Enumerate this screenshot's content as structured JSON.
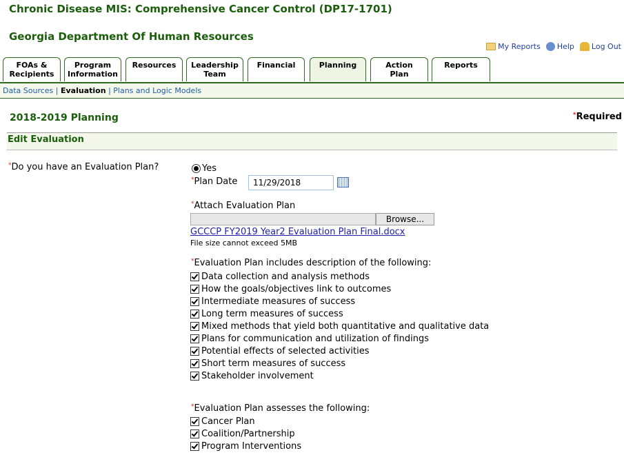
{
  "header": {
    "app_title": "Chronic Disease MIS: Comprehensive Cancer Control (DP17-1701)",
    "org": "Georgia Department Of Human Resources",
    "links": [
      "My Reports",
      "Help",
      "Log Out"
    ]
  },
  "tabs": [
    [
      "FOAs &",
      "Recipients"
    ],
    [
      "Program",
      "Information"
    ],
    [
      "Resources",
      ""
    ],
    [
      "Leadership",
      "Team"
    ],
    [
      "Financial",
      ""
    ],
    [
      "Planning",
      ""
    ],
    [
      "Action",
      "Plan"
    ],
    [
      "Reports",
      ""
    ]
  ],
  "subnav": [
    "Data Sources",
    "Evaluation",
    "Plans and Logic Models"
  ],
  "page": {
    "title": "2018-2019 Planning",
    "required": "Required",
    "section": "Edit Evaluation"
  },
  "form": {
    "question": "Do you have an Evaluation Plan?",
    "radio_yes": "Yes",
    "plan_date_label": "Plan Date",
    "plan_date": "11/29/2018",
    "attach_label": "Attach Evaluation Plan",
    "browse": "Browse...",
    "file_link": "GCCCP FY2019 Year2 Evaluation Plan Final.docx",
    "file_note": "File size cannot exceed 5MB",
    "includes_label": "Evaluation Plan includes description of the following:",
    "includes": [
      "Data collection and analysis methods",
      "How the goals/objectives link to outcomes",
      "Intermediate measures of success",
      "Long term measures of success",
      "Mixed methods that yield both quantitative and qualitative data",
      "Plans for communication and utilization of findings",
      "Potential effects of selected activities",
      "Short term measures of success",
      "Stakeholder involvement"
    ],
    "assesses_label": "Evaluation Plan assesses the following:",
    "assesses": [
      "Cancer Plan",
      "Coalition/Partnership",
      "Program Interventions"
    ]
  }
}
